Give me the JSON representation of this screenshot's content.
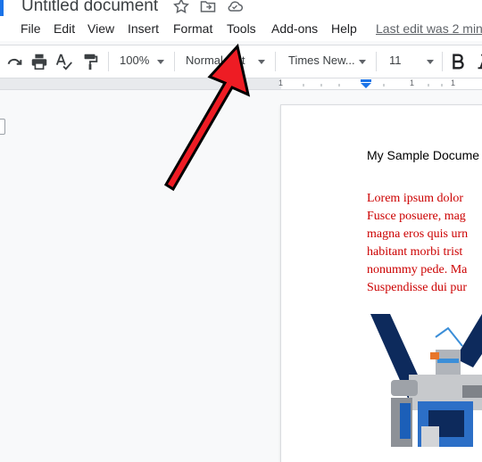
{
  "app": {
    "document_title": "Untitled document",
    "last_edit": "Last edit was 2 min",
    "accent_color": "#1a73e8"
  },
  "menu": {
    "items": [
      "File",
      "Edit",
      "View",
      "Insert",
      "Format",
      "Tools",
      "Add-ons",
      "Help"
    ]
  },
  "toolbar": {
    "zoom": "100%",
    "style": "Normal text",
    "font": "Times New...",
    "font_size": "11",
    "icons": [
      "redo-icon",
      "print-icon",
      "spellcheck-icon",
      "paint-format-icon",
      "bold-icon"
    ]
  },
  "ruler": {
    "labels": [
      "1",
      "1",
      "1"
    ]
  },
  "document": {
    "heading": "My Sample Docume",
    "body_lines": [
      "Lorem ipsum dolor",
      "Fusce posuere, mag",
      "magna eros quis urn",
      "habitant morbi trist",
      "nonummy pede. Ma",
      "Suspendisse dui pur"
    ],
    "body_color": "#cc0000"
  },
  "annotation": {
    "arrow_color": "#ee1c24"
  }
}
